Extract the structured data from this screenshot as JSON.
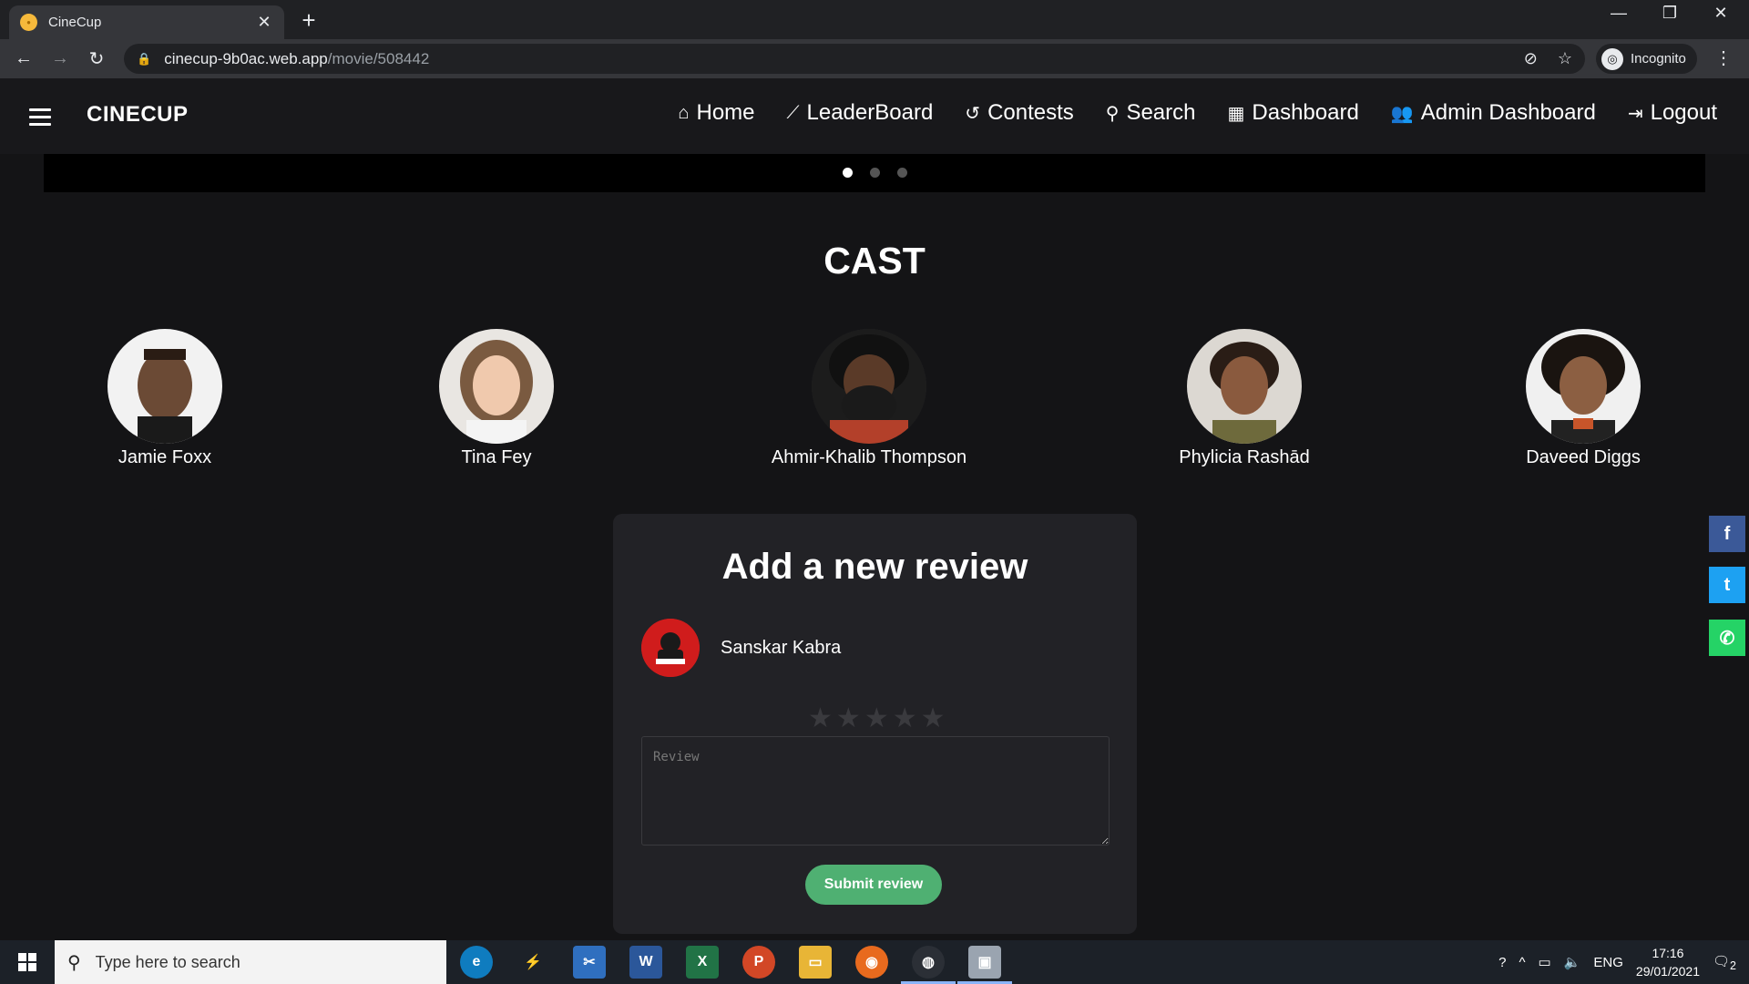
{
  "browser": {
    "tab_title": "CineCup",
    "tab_close": "✕",
    "new_tab": "+",
    "url_host": "cinecup-9b0ac.web.app",
    "url_path": "/movie/508442",
    "profile_label": "Incognito"
  },
  "nav": {
    "brand": "CINECUP",
    "links": [
      {
        "label": "Home",
        "icon": "home-icon",
        "glyph": "⌂"
      },
      {
        "label": "LeaderBoard",
        "icon": "trending-icon",
        "glyph": "⟋"
      },
      {
        "label": "Contests",
        "icon": "history-icon",
        "glyph": "↺"
      },
      {
        "label": "Search",
        "icon": "search-icon",
        "glyph": "⚲"
      },
      {
        "label": "Dashboard",
        "icon": "dashboard-icon",
        "glyph": "▦"
      },
      {
        "label": "Admin Dashboard",
        "icon": "people-icon",
        "glyph": "👥"
      },
      {
        "label": "Logout",
        "icon": "logout-icon",
        "glyph": "⇥"
      }
    ]
  },
  "carousel": {
    "slide_count": 3,
    "active_index": 0
  },
  "cast": {
    "title": "CAST",
    "members": [
      {
        "name": "Jamie Foxx"
      },
      {
        "name": "Tina Fey"
      },
      {
        "name": "Ahmir-Khalib Thompson"
      },
      {
        "name": "Phylicia Rashād"
      },
      {
        "name": "Daveed Diggs"
      }
    ]
  },
  "review": {
    "title": "Add a new review",
    "user_name": "Sanskar Kabra",
    "rating": 0,
    "rating_max": 5,
    "placeholder": "Review",
    "submit_label": "Submit review"
  },
  "social": [
    {
      "name": "facebook",
      "glyph": "f",
      "color": "#3b5998"
    },
    {
      "name": "twitter",
      "glyph": "t",
      "color": "#1da1f2"
    },
    {
      "name": "whatsapp",
      "glyph": "✆",
      "color": "#25d366"
    }
  ],
  "taskbar": {
    "search_placeholder": "Type here to search",
    "language": "ENG",
    "time": "17:16",
    "date": "29/01/2021",
    "notification_count": "2"
  }
}
